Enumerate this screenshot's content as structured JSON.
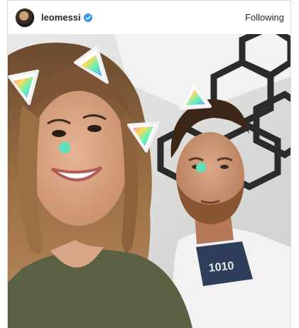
{
  "post": {
    "username": "leomessi",
    "verified": true,
    "follow_label": "Following",
    "icons": {
      "avatar": "profile-avatar",
      "verified": "verified-badge-icon"
    },
    "colors": {
      "verified_blue": "#3897f0",
      "border": "#dbdbdb"
    }
  }
}
